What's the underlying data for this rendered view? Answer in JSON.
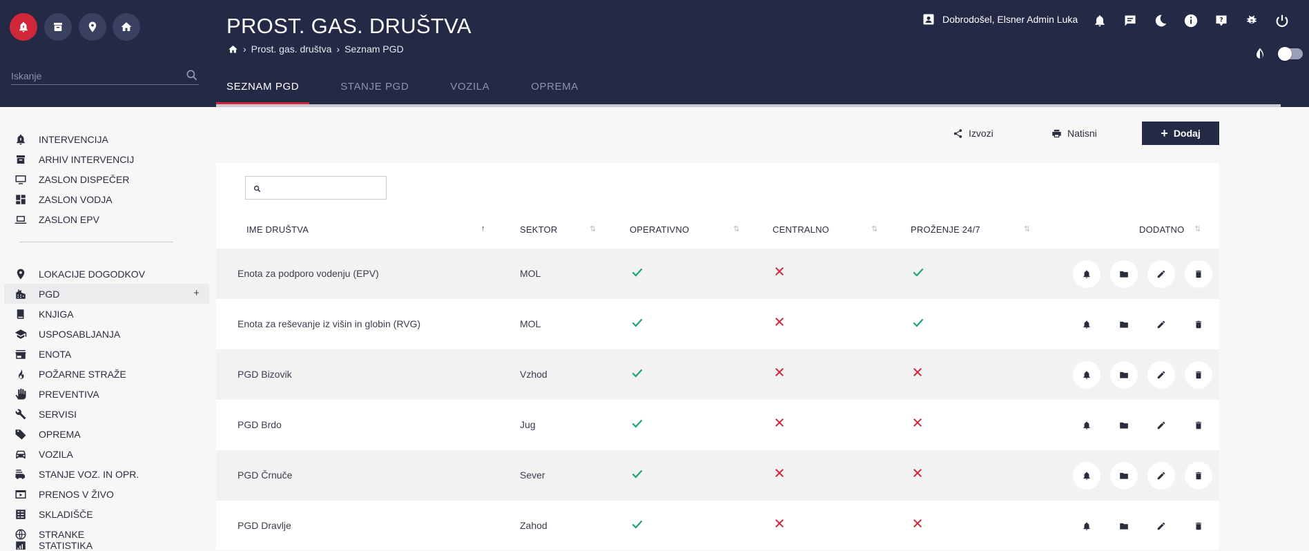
{
  "header": {
    "title": "PROST. GAS. DRUŠTVA",
    "breadcrumb": [
      "Prost. gas. društva",
      "Seznam PGD"
    ],
    "search_placeholder": "Iskanje",
    "user_greeting": "Dobrodošel, Elsner Admin Luka"
  },
  "tabs": [
    {
      "label": "SEZNAM PGD",
      "active": true
    },
    {
      "label": "STANJE PGD",
      "active": false
    },
    {
      "label": "VOZILA",
      "active": false
    },
    {
      "label": "OPREMA",
      "active": false
    }
  ],
  "sidebar": {
    "items": [
      {
        "label": "INTERVENCIJA",
        "icon": "alarm-bell-icon"
      },
      {
        "label": "ARHIV INTERVENCIJ",
        "icon": "archive-icon"
      },
      {
        "label": "ZASLON DISPEČER",
        "icon": "monitor-icon"
      },
      {
        "label": "ZASLON VODJA",
        "icon": "dashboard-icon"
      },
      {
        "label": "ZASLON EPV",
        "icon": "laptop-icon"
      },
      {
        "label": "LOKACIJE DOGODKOV",
        "icon": "location-pin-icon"
      },
      {
        "label": "PGD",
        "icon": "building-icon",
        "selected": true,
        "expand": "+"
      },
      {
        "label": "KNJIGA",
        "icon": "book-icon"
      },
      {
        "label": "USPOSABLJANJA",
        "icon": "graduation-cap-icon"
      },
      {
        "label": "ENOTA",
        "icon": "store-icon"
      },
      {
        "label": "POŽARNE STRAŽE",
        "icon": "fire-icon"
      },
      {
        "label": "PREVENTIVA",
        "icon": "hand-icon"
      },
      {
        "label": "SERVISI",
        "icon": "wrench-icon"
      },
      {
        "label": "OPREMA",
        "icon": "tag-icon"
      },
      {
        "label": "VOZILA",
        "icon": "car-icon"
      },
      {
        "label": "STANJE VOZ. IN OPR.",
        "icon": "fire-truck-icon"
      },
      {
        "label": "PRENOS V ŽIVO",
        "icon": "live-stream-icon"
      },
      {
        "label": "SKLADIŠČE",
        "icon": "warehouse-icon"
      },
      {
        "label": "STRANKE",
        "icon": "globe-icon"
      },
      {
        "label": "STATISTIKA",
        "icon": "chart-icon"
      }
    ]
  },
  "toolbar": {
    "export_label": "Izvozi",
    "print_label": "Natisni",
    "add_label": "Dodaj"
  },
  "table": {
    "search_value": "",
    "columns": [
      "IME DRUŠTVA",
      "SEKTOR",
      "OPERATIVNO",
      "CENTRALNO",
      "PROŽENJE 24/7",
      "DODATNO"
    ],
    "sorted_column": "IME DRUŠTVA",
    "rows": [
      {
        "name": "Enota za podporo vodenju (EPV)",
        "sector": "MOL",
        "operativno": true,
        "centralno": false,
        "prozenje": true
      },
      {
        "name": "Enota za reševanje iz višin in globin (RVG)",
        "sector": "MOL",
        "operativno": true,
        "centralno": false,
        "prozenje": true
      },
      {
        "name": "PGD Bizovik",
        "sector": "Vzhod",
        "operativno": true,
        "centralno": false,
        "prozenje": false
      },
      {
        "name": "PGD Brdo",
        "sector": "Jug",
        "operativno": true,
        "centralno": false,
        "prozenje": false
      },
      {
        "name": "PGD Črnuče",
        "sector": "Sever",
        "operativno": true,
        "centralno": false,
        "prozenje": false
      },
      {
        "name": "PGD Dravlje",
        "sector": "Zahod",
        "operativno": true,
        "centralno": false,
        "prozenje": false
      }
    ]
  },
  "colors": {
    "header_bg": "#242a45",
    "accent_red": "#d0283a",
    "check_green": "#1aa37a",
    "cross_red": "#d0283a"
  }
}
